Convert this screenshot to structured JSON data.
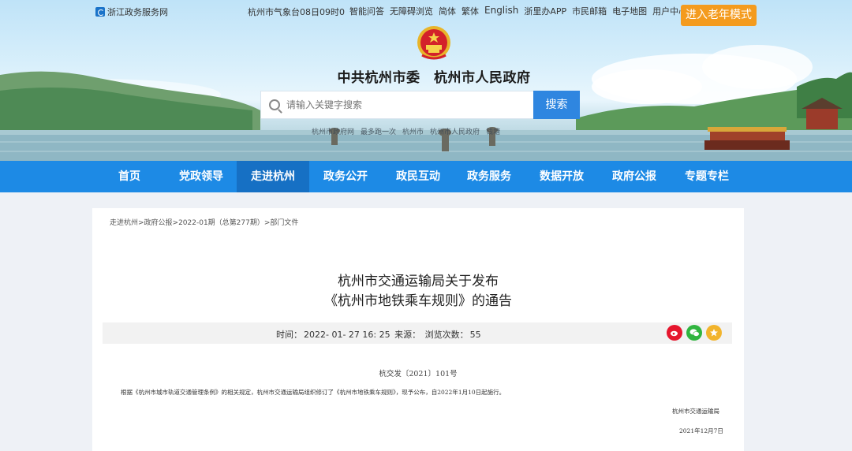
{
  "header": {
    "site_link": "浙江政务服务网",
    "weather": "杭州市气象台08日09时0",
    "links": [
      "智能问答",
      "无障碍浏览",
      "简体",
      "繁体",
      "English",
      "浙里办APP",
      "市民邮箱",
      "电子地图",
      "用户中心"
    ],
    "elder_mode": "进入老年模式",
    "gov_title": "中共杭州市委　杭州市人民政府",
    "search_placeholder": "请输入关键字搜索",
    "search_button": "搜索",
    "hotwords": [
      "杭州市政府网",
      "最多跑一次",
      "杭州市",
      "杭州市人民政府",
      "钱塘"
    ]
  },
  "nav": {
    "items": [
      "首页",
      "党政领导",
      "走进杭州",
      "政务公开",
      "政民互动",
      "政务服务",
      "数据开放",
      "政府公报",
      "专题专栏"
    ],
    "active": "走进杭州"
  },
  "article": {
    "breadcrumb": "走进杭州>政府公报>2022-01期（总第277期）>部门文件",
    "title_line1": "杭州市交通运输局关于发布",
    "title_line2": "《杭州市地铁乘车规则》的通告",
    "meta": {
      "time_label": "时间：",
      "time_value": "2022- 01- 27 16: 25",
      "source_label": "来源：",
      "views_label": "浏览次数：",
      "views_value": "55"
    },
    "doc_number": "杭交发〔2021〕101号",
    "body": "根据《杭州市城市轨道交通管理条例》的相关规定，杭州市交通运输局组织修订了《杭州市地铁乘车规则》，现予公布，自2022年1月10日起施行。",
    "sign_org": "杭州市交通运输局",
    "sign_date": "2021年12月7日"
  },
  "colors": {
    "nav_bg": "#1d8ae5",
    "nav_active": "#1670c4",
    "elder_button": "#f49b1e",
    "search_button": "#2f86e0"
  }
}
